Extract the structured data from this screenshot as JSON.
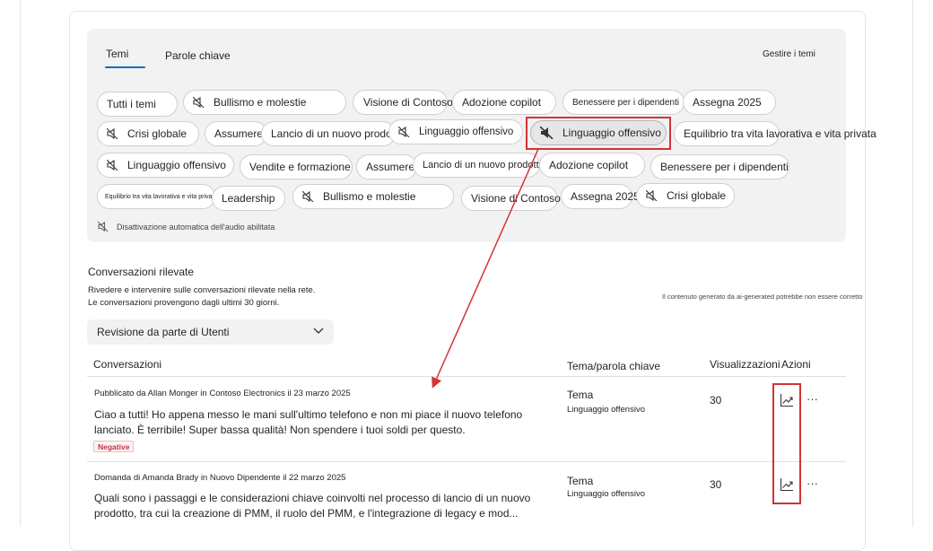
{
  "tabs": [
    {
      "label": "Temi",
      "active": true
    },
    {
      "label": "Parole chiave",
      "active": false
    }
  ],
  "manage_topics": "Gestire i temi",
  "pills": [
    {
      "label": "Tutti i temi",
      "muted": false
    },
    {
      "label": "Bullismo e molestie",
      "muted": true
    },
    {
      "label": "Visione di Contoso",
      "muted": false
    },
    {
      "label": "Adozione copilot",
      "muted": false
    },
    {
      "label": "Benessere per i dipendenti",
      "muted": false
    },
    {
      "label": "Assegna 2025",
      "muted": false
    },
    {
      "label": "Crisi globale",
      "muted": true
    },
    {
      "label": "Assumere",
      "muted": false
    },
    {
      "label": "Lancio di un nuovo prodotto",
      "muted": false
    },
    {
      "label": "Linguaggio offensivo",
      "muted": true
    },
    {
      "label": "Linguaggio offensivo",
      "muted": true,
      "selected": true
    },
    {
      "label": "Equilibrio tra vita lavorativa e vita privata",
      "muted": false
    },
    {
      "label": "Linguaggio offensivo",
      "muted": true
    },
    {
      "label": "Vendite e formazione",
      "muted": false
    },
    {
      "label": "Assumere",
      "muted": false
    },
    {
      "label": "Lancio di un nuovo prodotto",
      "muted": false
    },
    {
      "label": "Adozione copilot",
      "muted": false
    },
    {
      "label": "Benessere per i dipendenti",
      "muted": false
    },
    {
      "label": "Equilibrio tra vita lavorativa e vita privata",
      "muted": false
    },
    {
      "label": "Leadership",
      "muted": false
    },
    {
      "label": "Bullismo e molestie",
      "muted": true
    },
    {
      "label": "Visione di Contoso",
      "muted": false
    },
    {
      "label": "Assegna 2025",
      "muted": false
    },
    {
      "label": "Crisi globale",
      "muted": true
    }
  ],
  "auto_mute_text": "Disattivazione automatica dell'audio abilitata",
  "section": {
    "title": "Conversazioni rilevate",
    "desc_line1": "Rivedere e intervenire sulle conversazioni rilevate nella rete.",
    "desc_line2": "Le conversazioni provengono dagli ultimi 30 giorni.",
    "ai_note": "Il contenuto generato da ai-generated potrebbe non essere corretto"
  },
  "filter": {
    "label": "Revisione da parte di Utenti"
  },
  "table": {
    "headers": {
      "conversations": "Conversazioni",
      "topic": "Tema/parola chiave",
      "views": "Visualizzazioni",
      "actions": "Azioni"
    },
    "rows": [
      {
        "meta": "Pubblicato da Allan Monger in Contoso Electronics il 23 marzo 2025",
        "text": "Ciao a tutti! Ho appena messo le mani sull'ultimo telefono e non mi piace il nuovo telefono lanciato. È terribile! Super bassa qualità! Non spendere i tuoi soldi per questo.",
        "badge": "Negative",
        "topic_type": "Tema",
        "topic_name": "Linguaggio offensivo",
        "views": "30",
        "more": "···"
      },
      {
        "meta": "Domanda di Amanda Brady in Nuovo Dipendente il 22 marzo 2025",
        "text": "Quali sono i passaggi e le considerazioni chiave coinvolti nel processo di lancio di un nuovo prodotto, tra cui la creazione di PMM, il ruolo del PMM, e l'integrazione di legacy e mod...",
        "badge": "",
        "topic_type": "Tema",
        "topic_name": "Linguaggio offensivo",
        "views": "30",
        "more": "···"
      }
    ]
  },
  "colors": {
    "accent": "#0f6cbd",
    "annotation": "#d13438",
    "negative": "#c4314b"
  },
  "icons": {
    "muted": "speaker-muted-icon",
    "trend": "trend-chart-icon",
    "chevron": "chevron-down-icon"
  }
}
